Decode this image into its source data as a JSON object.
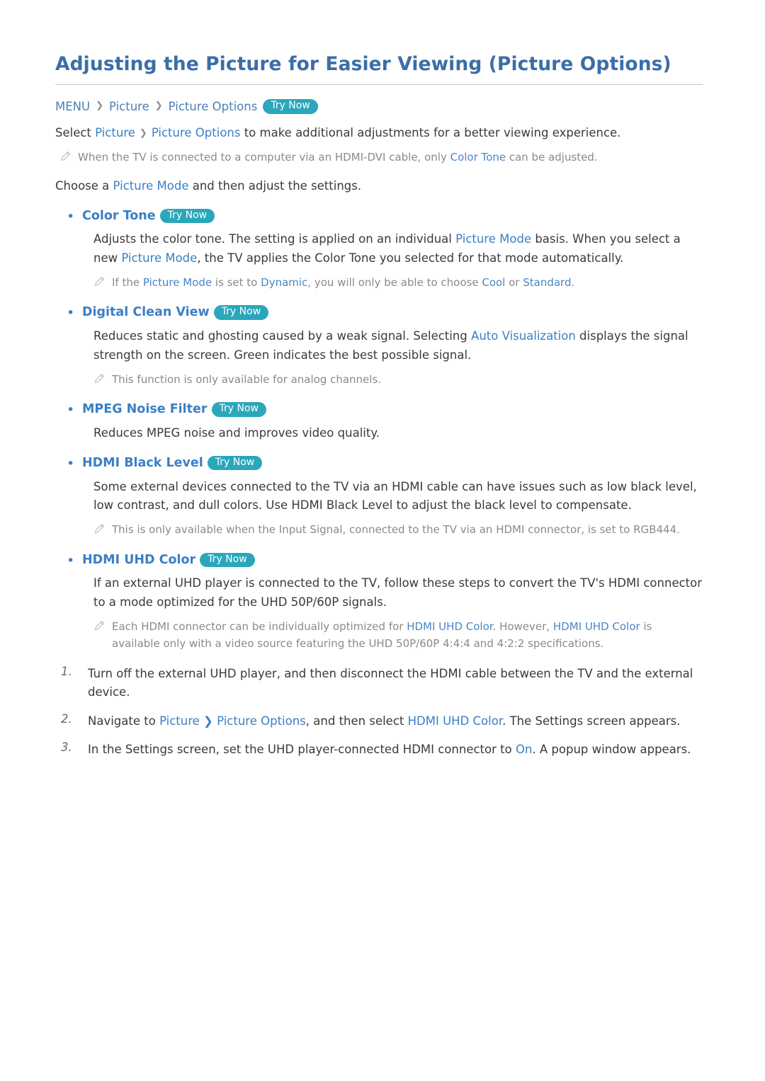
{
  "title": "Adjusting the Picture for Easier Viewing (Picture Options)",
  "menu_path": {
    "root": "MENU",
    "level1": "Picture",
    "level2": "Picture Options",
    "try_now": "Try Now",
    "chevron": "❯"
  },
  "intro": {
    "pre": "Select ",
    "link1": "Picture",
    "sep": "❯",
    "link2": "Picture Options",
    "post": " to make additional adjustments for a better viewing experience."
  },
  "note_hdmi_dvi": {
    "icon": "pencil-icon",
    "pre": "When the TV is connected to a computer via an HDMI-DVI cable, only ",
    "hl": "Color Tone",
    "post": " can be adjusted."
  },
  "choose_line": {
    "pre": "Choose a ",
    "hl": "Picture Mode",
    "post": " and then adjust the settings."
  },
  "sections": [
    {
      "label": "Color Tone",
      "try_now": "Try Now",
      "body_parts": [
        {
          "t": "Adjusts the color tone. The setting is applied on an individual ",
          "hl": false
        },
        {
          "t": "Picture Mode",
          "hl": true
        },
        {
          "t": " basis. When you select a new ",
          "hl": false
        },
        {
          "t": "Picture Mode",
          "hl": true
        },
        {
          "t": ", the TV applies the Color Tone you selected for that mode automatically.",
          "hl": false
        }
      ],
      "note": {
        "parts": [
          {
            "t": "If the ",
            "hl": false
          },
          {
            "t": "Picture Mode",
            "hl": true
          },
          {
            "t": " is set to ",
            "hl": false
          },
          {
            "t": "Dynamic",
            "hl": true
          },
          {
            "t": ", you will only be able to choose ",
            "hl": false
          },
          {
            "t": "Cool",
            "hl": true
          },
          {
            "t": " or ",
            "hl": false
          },
          {
            "t": "Standard",
            "hl": true
          },
          {
            "t": ".",
            "hl": false
          }
        ]
      }
    },
    {
      "label": "Digital Clean View",
      "try_now": "Try Now",
      "body_parts": [
        {
          "t": "Reduces static and ghosting caused by a weak signal. Selecting ",
          "hl": false
        },
        {
          "t": "Auto Visualization",
          "hl": true
        },
        {
          "t": " displays the signal strength on the screen. Green indicates the best possible signal.",
          "hl": false
        }
      ],
      "note": {
        "parts": [
          {
            "t": "This function is only available for analog channels.",
            "hl": false
          }
        ]
      }
    },
    {
      "label": "MPEG Noise Filter",
      "try_now": "Try Now",
      "body_parts": [
        {
          "t": "Reduces MPEG noise and improves video quality.",
          "hl": false
        }
      ],
      "note": null
    },
    {
      "label": "HDMI Black Level",
      "try_now": "Try Now",
      "body_parts": [
        {
          "t": "Some external devices connected to the TV via an HDMI cable can have issues such as low black level, low contrast, and dull colors. Use HDMI Black Level to adjust the black level to compensate.",
          "hl": false
        }
      ],
      "note": {
        "parts": [
          {
            "t": "This is only available when the Input Signal, connected to the TV via an HDMI connector, is set to RGB444.",
            "hl": false
          }
        ]
      }
    },
    {
      "label": "HDMI UHD Color",
      "try_now": "Try Now",
      "body_parts": [
        {
          "t": "If an external UHD player is connected to the TV, follow these steps to convert the TV's HDMI connector to a mode optimized for the UHD 50P/60P signals.",
          "hl": false
        }
      ],
      "note": {
        "parts": [
          {
            "t": "Each HDMI connector can be individually optimized for ",
            "hl": false
          },
          {
            "t": "HDMI UHD Color",
            "hl": true
          },
          {
            "t": ". However, ",
            "hl": false
          },
          {
            "t": "HDMI UHD Color",
            "hl": true
          },
          {
            "t": " is available only with a video source featuring the UHD 50P/60P 4:4:4 and 4:2:2 specifications.",
            "hl": false
          }
        ]
      }
    }
  ],
  "steps": [
    {
      "num": "1.",
      "parts": [
        {
          "t": "Turn off the external UHD player, and then disconnect the HDMI cable between the TV and the external device.",
          "hl": false
        }
      ]
    },
    {
      "num": "2.",
      "parts": [
        {
          "t": "Navigate to ",
          "hl": false
        },
        {
          "t": "Picture",
          "hl": true
        },
        {
          "t": " ❯ ",
          "hl": true
        },
        {
          "t": "Picture Options",
          "hl": true
        },
        {
          "t": ", and then select ",
          "hl": false
        },
        {
          "t": "HDMI UHD Color",
          "hl": true
        },
        {
          "t": ". The Settings screen appears.",
          "hl": false
        }
      ]
    },
    {
      "num": "3.",
      "parts": [
        {
          "t": "In the Settings screen, set the UHD player-connected HDMI connector to ",
          "hl": false
        },
        {
          "t": "On",
          "hl": true
        },
        {
          "t": ". A popup window appears.",
          "hl": false
        }
      ]
    }
  ],
  "colors": {
    "heading": "#3b6ea8",
    "link": "#3b7fc4",
    "badge": "#2aa7bb",
    "note": "#8a8a8a"
  }
}
